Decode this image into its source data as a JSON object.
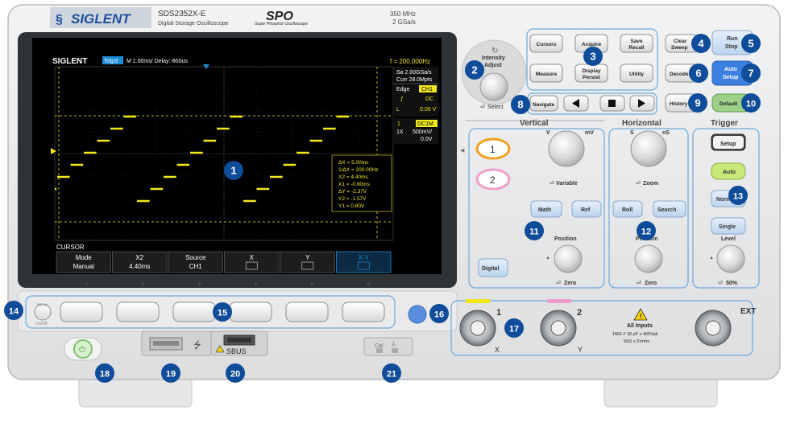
{
  "brand": {
    "logo": "SIGLENT",
    "model": "SDS2352X-E",
    "subtitle": "Digital Storage Oscilloscope",
    "spo_logo": "SPO",
    "spo_subtitle": "Super Phosphor Oscilloscope",
    "bandwidth": "350 MHz",
    "sample_rate": "2 GSa/s"
  },
  "screen": {
    "logo": "SIGLENT",
    "trig_status": "Trig'd",
    "timebase": "M 1.00ms/ Delay:-800us",
    "frequency": "f = 200.000Hz",
    "sa_rate": "Sa 2.00GSa/s",
    "curr_points": "Curr 28.0Mpts",
    "trig_type": "Edge",
    "trig_source": "CH1",
    "trig_slope": "ƒ",
    "trig_coupling": "DC",
    "trig_l": "L",
    "trig_level": "0.00 V",
    "ch_num": "1",
    "ch_coupling": "DC1M",
    "ch_probe": "1X",
    "ch_scale": "500mV/",
    "ch_offset": "0.0V",
    "ch_marker": "1",
    "cursor_readout": [
      "ΔX = 5.00ms",
      "1/ΔX = 200.00Hz",
      "X2 = 4.40ms",
      "X1 = -0.60ms",
      "ΔY = -2.37V",
      "Y2 = -1.57V",
      "Y1 = 0.80V"
    ],
    "menu_title": "CURSOR",
    "menu": [
      {
        "top": "Mode",
        "bottom": "Manual"
      },
      {
        "top": "X2",
        "bottom": "4.40ms"
      },
      {
        "top": "Source",
        "bottom": "CH1"
      },
      {
        "top": "X",
        "bottom": ""
      },
      {
        "top": "Y",
        "bottom": ""
      },
      {
        "top": "X-Y",
        "bottom": ""
      }
    ],
    "softkey_numbers": [
      "1",
      "2",
      "3",
      "4",
      "5",
      "6"
    ]
  },
  "buttons": {
    "cursors": "Cursors",
    "acquire": "Acquire",
    "save_recall": [
      "Save",
      "Recall"
    ],
    "measure": "Measure",
    "display_persist": [
      "Display",
      "Persist"
    ],
    "utility": "Utility",
    "clear_sweep": [
      "Clear",
      "Sweep"
    ],
    "run_stop": [
      "Run",
      "Stop"
    ],
    "decode": "Decode",
    "auto_setup": [
      "Auto",
      "Setup"
    ],
    "history": "History",
    "default": "Default",
    "navigate": "Navigate",
    "intensity_adjust": [
      "Intensity",
      "Adjust"
    ],
    "select": "Select",
    "ch1": "1",
    "ch2": "2",
    "math": "Math",
    "ref": "Ref",
    "digital": "Digital",
    "roll": "Roll",
    "search": "Search",
    "trig_setup": "Setup",
    "trig_auto": "Auto",
    "trig_normal": "Normal",
    "trig_single": "Single",
    "menu_on_off": [
      "Menu",
      "On/Off"
    ]
  },
  "sections": {
    "vertical": "Vertical",
    "horizontal": "Horizontal",
    "trigger": "Trigger"
  },
  "knob_labels": {
    "v": "V",
    "mv": "mV",
    "variable": "Variable",
    "v_position": "Position",
    "v_zero": "Zero",
    "s": "S",
    "ns": "nS",
    "zoom": "Zoom",
    "h_position": "Position",
    "h_zero": "Zero",
    "level": "Level",
    "fifty": "50%"
  },
  "inputs": {
    "ch1_num": "1",
    "ch2_num": "2",
    "ext": "EXT",
    "x_label": "X",
    "y_label": "Y",
    "warning_title": "All Inputs",
    "warning_line1": "1MΩ // 18 pF ≤ 400Vpk",
    "warning_line2": "50Ω ≤ 5Vrms",
    "sbus": "SBUS",
    "cal": "Cal"
  },
  "callouts": [
    "1",
    "2",
    "3",
    "4",
    "5",
    "6",
    "7",
    "8",
    "9",
    "10",
    "11",
    "12",
    "13",
    "14",
    "15",
    "16",
    "17",
    "18",
    "19",
    "20",
    "21"
  ],
  "colors": {
    "trace": "#f2e81a",
    "callout": "#0f4c9a",
    "run_stop": "#c7daf0",
    "auto_setup": "#3b7fe0",
    "default": "#9fd08a",
    "trig_auto": "#c7e87a",
    "ch1_ring": "#f2a020",
    "ch2_ring": "#f0a0c8",
    "screen_status_blue": "#1d8dd6"
  }
}
